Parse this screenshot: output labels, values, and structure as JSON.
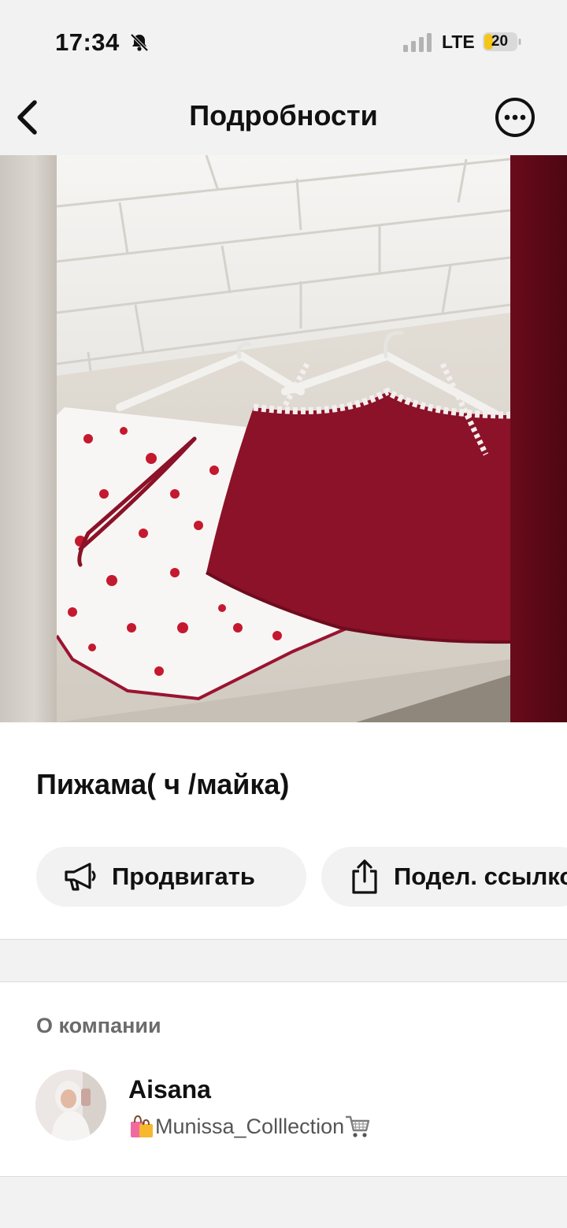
{
  "status_bar": {
    "time": "17:34",
    "network": "LTE",
    "battery": "20",
    "icons": {
      "silent": "bell-slash-icon",
      "signal": "signal-bars-icon",
      "battery": "battery-icon"
    }
  },
  "nav": {
    "title": "Подробности",
    "back_icon": "chevron-left-icon",
    "more_icon": "ellipsis-circle-icon"
  },
  "product": {
    "title": "Пижама( ч /майка)",
    "image_alt": "pajama-set-photo"
  },
  "actions": {
    "promote": {
      "label": "Продвигать",
      "icon": "megaphone-icon"
    },
    "share": {
      "label": "Подел. ссылкой",
      "icon": "share-icon"
    }
  },
  "company": {
    "heading": "О компании",
    "seller_name": "Aisana",
    "shop_name": "Munissa_Colllection",
    "shop_prefix_icon": "shopping-bags-icon",
    "shop_suffix_icon": "shopping-cart-icon"
  },
  "colors": {
    "background": "#f2f2f2",
    "surface": "#ffffff",
    "text": "#111111",
    "muted": "#6b6b6b",
    "battery_fill": "#f5c518",
    "garment": "#8b1228"
  }
}
